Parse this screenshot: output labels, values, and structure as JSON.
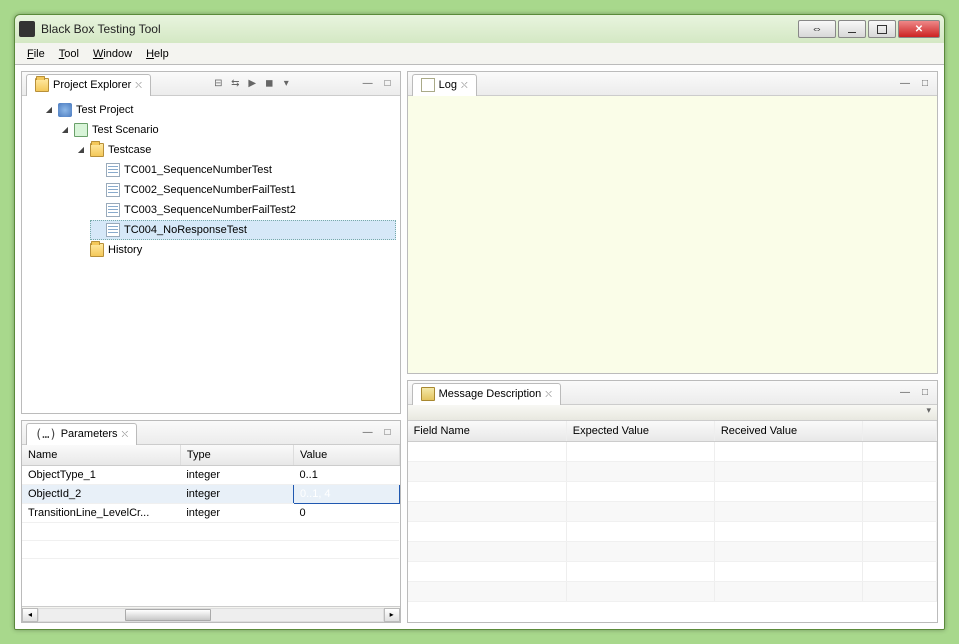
{
  "window": {
    "title": "Black Box Testing Tool"
  },
  "menubar": {
    "file": "File",
    "tool": "Tool",
    "window": "Window",
    "help": "Help"
  },
  "projectExplorer": {
    "tabLabel": "Project Explorer",
    "tree": {
      "root": "Test Project",
      "scenario": "Test Scenario",
      "testcaseFolder": "Testcase",
      "items": [
        "TC001_SequenceNumberTest",
        "TC002_SequenceNumberFailTest1",
        "TC003_SequenceNumberFailTest2",
        "TC004_NoResponseTest"
      ],
      "historyFolder": "History"
    }
  },
  "logPane": {
    "tabLabel": "Log"
  },
  "paramsPane": {
    "tabLabel": "Parameters",
    "columns": {
      "name": "Name",
      "type": "Type",
      "value": "Value"
    },
    "rows": [
      {
        "name": "ObjectType_1",
        "type": "integer",
        "value": "0..1"
      },
      {
        "name": "ObjectId_2",
        "type": "integer",
        "value": "0..1, 4"
      },
      {
        "name": "TransitionLine_LevelCr...",
        "type": "integer",
        "value": "0"
      }
    ],
    "selectedRowIndex": 1,
    "editingCell": {
      "row": 1,
      "col": "value"
    }
  },
  "msgPane": {
    "tabLabel": "Message Description",
    "columns": {
      "field": "Field Name",
      "expected": "Expected Value",
      "received": "Received Value"
    },
    "emptyRows": 8
  }
}
